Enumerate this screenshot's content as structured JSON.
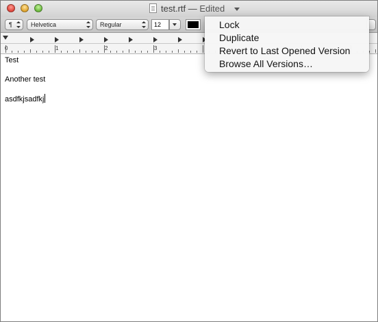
{
  "window": {
    "title": "test.rtf",
    "separator": "—",
    "edited_label": "Edited"
  },
  "toolbar": {
    "paragraph_style": "¶",
    "font_family": "Helvetica",
    "font_typeface": "Regular",
    "font_size": "12",
    "text_color": "#000000"
  },
  "ruler": {
    "labels": [
      "0",
      "1",
      "2",
      "3"
    ]
  },
  "document": {
    "paragraphs": [
      "Test",
      "Another test",
      "asdfkjsadfkj"
    ]
  },
  "title_menu": {
    "items": [
      "Lock",
      "Duplicate",
      "Revert to Last Opened Version",
      "Browse All Versions…"
    ]
  },
  "icons": {
    "document": "rtf-document-icon",
    "menu_indicator": "chevron-down-icon"
  }
}
